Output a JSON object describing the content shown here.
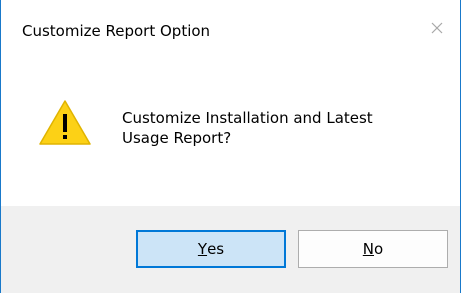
{
  "window": {
    "title": "Customize Report Option"
  },
  "icons": {
    "close": "close-icon",
    "warning": "warning-icon"
  },
  "message": {
    "line1": "Customize Installation and Latest",
    "line2": "Usage Report?"
  },
  "buttons": {
    "yes": {
      "mnemonic": "Y",
      "rest": "es"
    },
    "no": {
      "mnemonic": "N",
      "rest": "o"
    }
  },
  "colors": {
    "accent_border": "#1979ca",
    "default_button_bg": "#cce4f7",
    "default_button_border": "#0078d7",
    "footer_bg": "#f0f0f0",
    "warning_fill": "#fcd116"
  }
}
